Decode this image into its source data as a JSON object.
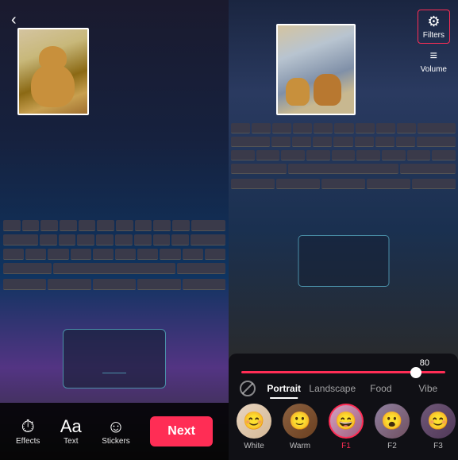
{
  "left": {
    "back_arrow": "‹",
    "toolbar": {
      "effects_label": "Effects",
      "text_label": "Text",
      "stickers_label": "Stickers",
      "next_label": "Next"
    }
  },
  "right": {
    "filters_label": "Filters",
    "volume_label": "Volume",
    "slider_value": "80",
    "filter_tabs": [
      {
        "id": "portrait",
        "label": "Portrait",
        "active": true
      },
      {
        "id": "landscape",
        "label": "Landscape",
        "active": false
      },
      {
        "id": "food",
        "label": "Food",
        "active": false
      },
      {
        "id": "vibe",
        "label": "Vibe",
        "active": false
      }
    ],
    "filter_items": [
      {
        "id": "white",
        "name": "White",
        "selected": false,
        "emoji": "😊",
        "bg": "av-white"
      },
      {
        "id": "warm",
        "name": "Warm",
        "selected": false,
        "emoji": "🙂",
        "bg": "av-warm"
      },
      {
        "id": "f1",
        "name": "F1",
        "selected": true,
        "emoji": "😄",
        "bg": "av-f1"
      },
      {
        "id": "f2",
        "name": "F2",
        "selected": false,
        "emoji": "😮",
        "bg": "av-f2"
      },
      {
        "id": "f3",
        "name": "F3",
        "selected": false,
        "emoji": "😊",
        "bg": "av-f3"
      }
    ]
  }
}
